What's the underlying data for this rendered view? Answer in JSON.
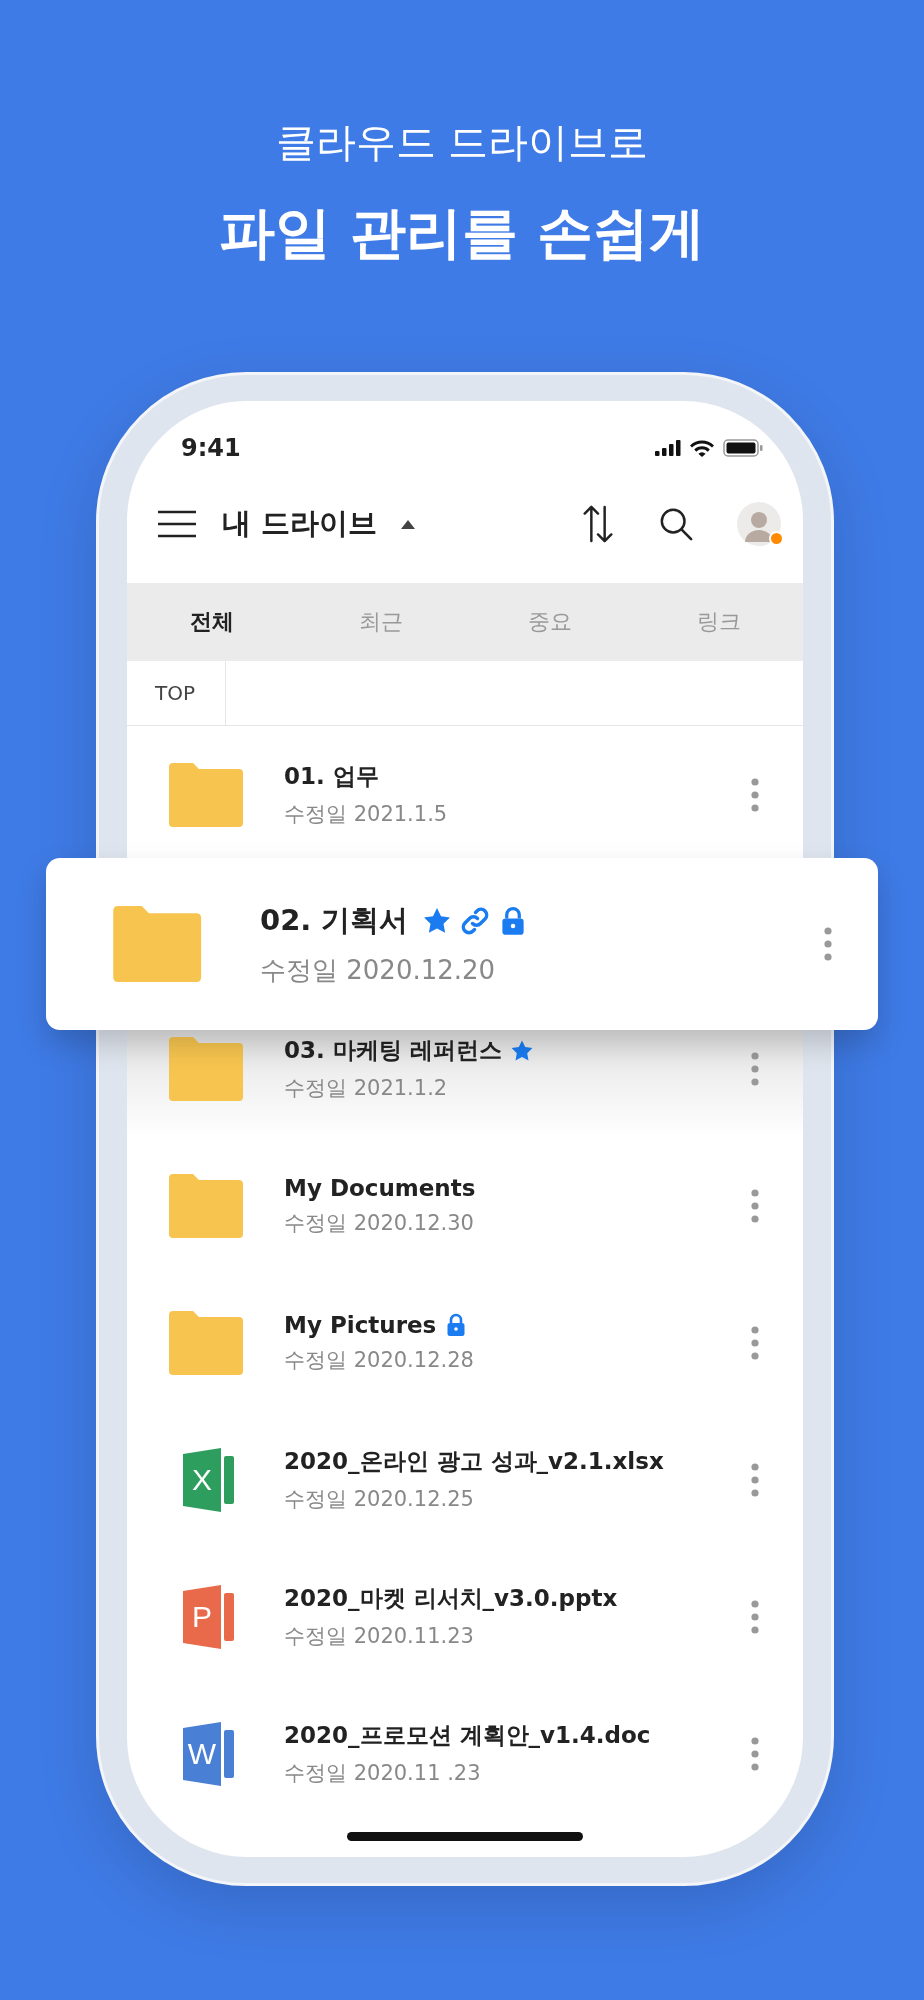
{
  "promo": {
    "subtitle": "클라우드 드라이브로",
    "title": "파일 관리를 손쉽게"
  },
  "status_bar": {
    "time": "9:41"
  },
  "header": {
    "title": "내 드라이브",
    "avatar": {
      "online": true
    }
  },
  "tabs": [
    {
      "label": "전체",
      "selected": true
    },
    {
      "label": "최근",
      "selected": false
    },
    {
      "label": "중요",
      "selected": false
    },
    {
      "label": "링크",
      "selected": false
    }
  ],
  "breadcrumb": [
    "TOP"
  ],
  "files": [
    {
      "kind": "folder",
      "name": "01. 업무",
      "modified": "수정일 2021.1.5",
      "starred": false,
      "linked": false,
      "locked": false,
      "lifted": false
    },
    {
      "kind": "folder",
      "name": "02. 기획서",
      "modified": "수정일 2020.12.20",
      "starred": true,
      "linked": true,
      "locked": true,
      "lifted": true
    },
    {
      "kind": "folder",
      "name": "03. 마케팅 레퍼런스",
      "modified": "수정일 2021.1.2",
      "starred": true,
      "linked": false,
      "locked": false,
      "lifted": false
    },
    {
      "kind": "folder",
      "name": "My Documents",
      "modified": "수정일 2020.12.30",
      "starred": false,
      "linked": false,
      "locked": false,
      "lifted": false
    },
    {
      "kind": "folder",
      "name": "My Pictures",
      "modified": "수정일 2020.12.28",
      "starred": false,
      "linked": false,
      "locked": true,
      "lifted": false
    },
    {
      "kind": "spreadsheet",
      "icon_letter": "X",
      "name": "2020_온라인 광고 성과_v2.1.xlsx",
      "modified": "수정일 2020.12.25",
      "starred": false,
      "linked": false,
      "locked": false,
      "lifted": false
    },
    {
      "kind": "presentation",
      "icon_letter": "P",
      "name": "2020_마켓 리서치_v3.0.pptx",
      "modified": "수정일 2020.11.23",
      "starred": false,
      "linked": false,
      "locked": false,
      "lifted": false
    },
    {
      "kind": "document",
      "icon_letter": "W",
      "name": "2020_프로모션 계획안_v1.4.doc",
      "modified": "수정일 2020.11 .23",
      "starred": false,
      "linked": false,
      "locked": false,
      "lifted": false
    }
  ]
}
